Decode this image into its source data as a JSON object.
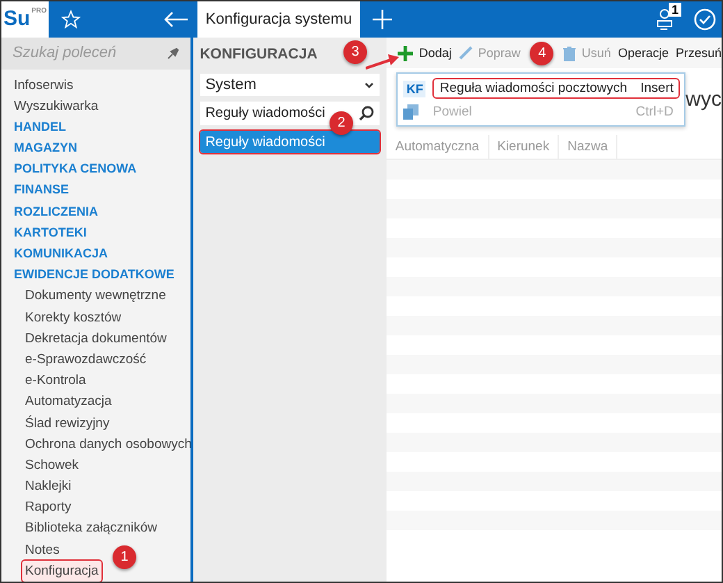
{
  "app": {
    "logo": "Su",
    "logo_sup": "PRO",
    "tab_title": "Konfiguracja systemu",
    "notification_count": "1"
  },
  "sidebar": {
    "search_placeholder": "Szukaj poleceń",
    "items": [
      {
        "label": "Infoserwis",
        "kind": "link",
        "highlighted": false
      },
      {
        "label": "Wyszukiwarka",
        "kind": "link",
        "highlighted": false
      },
      {
        "label": "HANDEL",
        "kind": "section",
        "highlighted": false
      },
      {
        "label": "MAGAZYN",
        "kind": "section",
        "highlighted": false
      },
      {
        "label": "POLITYKA CENOWA",
        "kind": "section",
        "highlighted": false
      },
      {
        "label": "FINANSE",
        "kind": "section",
        "highlighted": false
      },
      {
        "label": "ROZLICZENIA",
        "kind": "section",
        "highlighted": false
      },
      {
        "label": "KARTOTEKI",
        "kind": "section",
        "highlighted": false
      },
      {
        "label": "KOMUNIKACJA",
        "kind": "section",
        "highlighted": false
      },
      {
        "label": "EWIDENCJE DODATKOWE",
        "kind": "section",
        "highlighted": false,
        "children": [
          {
            "label": "Dokumenty wewnętrzne",
            "highlighted": false
          },
          {
            "label": "Korekty kosztów",
            "highlighted": false
          },
          {
            "label": "Dekretacja dokumentów",
            "highlighted": false
          },
          {
            "label": "e-Sprawozdawczość",
            "highlighted": false
          },
          {
            "label": "e-Kontrola",
            "highlighted": false
          },
          {
            "label": "Automatyzacja",
            "highlighted": false
          },
          {
            "label": "Ślad rewizyjny",
            "highlighted": false
          },
          {
            "label": "Ochrona danych osobowych",
            "highlighted": false
          },
          {
            "label": "Schowek",
            "highlighted": false
          },
          {
            "label": "Naklejki",
            "highlighted": false
          },
          {
            "label": "Raporty",
            "highlighted": false
          },
          {
            "label": "Biblioteka załączników",
            "highlighted": false
          },
          {
            "label": "Notes",
            "highlighted": false
          },
          {
            "label": "Konfiguracja",
            "highlighted": true
          }
        ]
      }
    ]
  },
  "config_panel": {
    "heading": "KONFIGURACJA",
    "dropdown": "System",
    "search_value": "Reguły wiadomości",
    "results": [
      {
        "label": "Reguły wiadomości",
        "selected": true,
        "highlighted": true
      }
    ]
  },
  "toolbar": [
    {
      "label": "Dodaj",
      "kind": "add",
      "disabled": false
    },
    {
      "label": "Popraw",
      "kind": "edit",
      "disabled": true
    },
    {
      "label": "Usuń",
      "kind": "delete",
      "disabled": true
    },
    {
      "label": "Operacje",
      "kind": "text",
      "disabled": false
    },
    {
      "label": "Przesuń",
      "kind": "text",
      "disabled": false
    }
  ],
  "add_menu": [
    {
      "badge": "KF",
      "label": "Reguła wiadomości pocztowych",
      "shortcut": "Insert",
      "kind": "badge",
      "disabled": false,
      "highlighted": true
    },
    {
      "label": "Powiel",
      "shortcut": "Ctrl+D",
      "kind": "copy",
      "disabled": true,
      "highlighted": false
    }
  ],
  "heading_fragment": "wyc",
  "table": {
    "columns": [
      "Automatyczna",
      "Kierunek",
      "Nazwa"
    ]
  },
  "callouts": [
    "1",
    "2",
    "3",
    "4"
  ]
}
